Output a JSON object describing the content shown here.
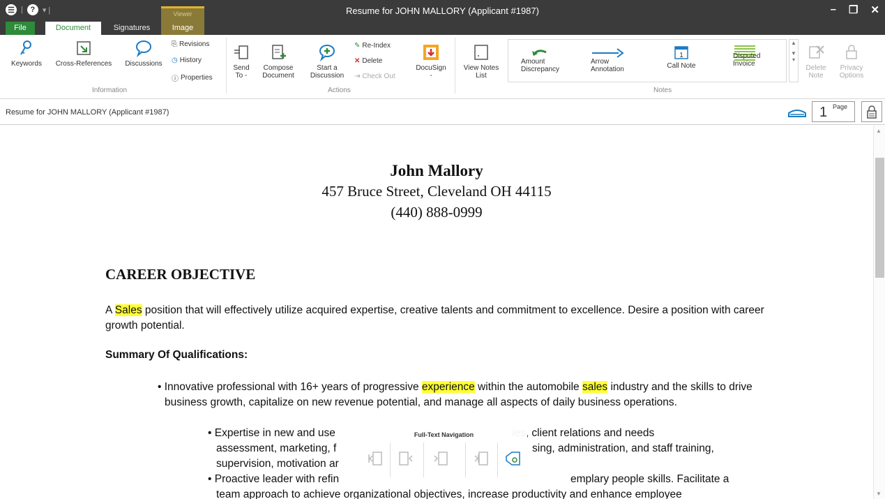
{
  "window": {
    "title": "Resume for JOHN MALLORY (Applicant #1987)",
    "context_tab_header": "Viewer",
    "minimize": "–",
    "restore": "❐",
    "close": "✕"
  },
  "tabs": [
    "File",
    "Document",
    "Signatures",
    "Image"
  ],
  "ribbon": {
    "information": {
      "label": "Information",
      "keywords": "Keywords",
      "cross_references": "Cross-References",
      "discussions": "Discussions",
      "revisions": "Revisions",
      "history": "History",
      "properties": "Properties"
    },
    "actions": {
      "label": "Actions",
      "send_to": [
        "Send",
        "To -"
      ],
      "compose_document": [
        "Compose",
        "Document"
      ],
      "start_discussion": [
        "Start a",
        "Discussion"
      ],
      "re_index": "Re-Index",
      "delete": "Delete",
      "check_out": "Check Out",
      "docusign": "DocuSign",
      "docusign_arrow": "-"
    },
    "view_notes_list": [
      "View Notes",
      "List"
    ],
    "notes": {
      "label": "Notes",
      "amount_discrepancy": [
        "Amount",
        "Discrepancy"
      ],
      "arrow_annotation": [
        "Arrow",
        "Annotation"
      ],
      "call_note": "Call Note",
      "disputed_invoice": [
        "Disputed",
        "Invoice"
      ],
      "delete_note": [
        "Delete",
        "Note"
      ],
      "privacy_options": [
        "Privacy",
        "Options"
      ]
    }
  },
  "doc_header": {
    "title": "Resume for JOHN MALLORY (Applicant #1987)",
    "page_number": "1",
    "page_label": "Page"
  },
  "document": {
    "name": "John Mallory",
    "address": "457 Bruce Street, Cleveland OH 44115",
    "phone": "(440) 888-0999",
    "objective_heading": "CAREER OBJECTIVE",
    "objective_pre": "A ",
    "objective_hl": "Sales",
    "objective_post": " position that will effectively utilize acquired expertise, creative talents and commitment to excellence. Desire a position with career growth potential.",
    "summary_heading": "Summary Of Qualifications:",
    "bullet1_a": "• Innovative professional with 16+ years of progressive ",
    "bullet1_hl1": "experience",
    "bullet1_b": " within the automobile ",
    "bullet1_hl2": "sales",
    "bullet1_c": " industry and the skills to drive business growth, capitalize on new revenue potential, and manage all aspects of daily business operations.",
    "bullet2": "• Expertise in new and use",
    "bullet2_tail": "ies, client relations and needs",
    "bullet2_line2": "assessment, marketing, f",
    "bullet2_line2_tail": "sing, administration, and staff training,",
    "bullet2_line3": "supervision, motivation ar",
    "bullet3": "• Proactive leader with refin",
    "bullet3_tail": "emplary people skills. Facilitate a",
    "bullet3_line2": "team approach to achieve organizational objectives, increase productivity and enhance employee"
  },
  "full_text_nav": {
    "title": "Full-Text Navigation"
  }
}
